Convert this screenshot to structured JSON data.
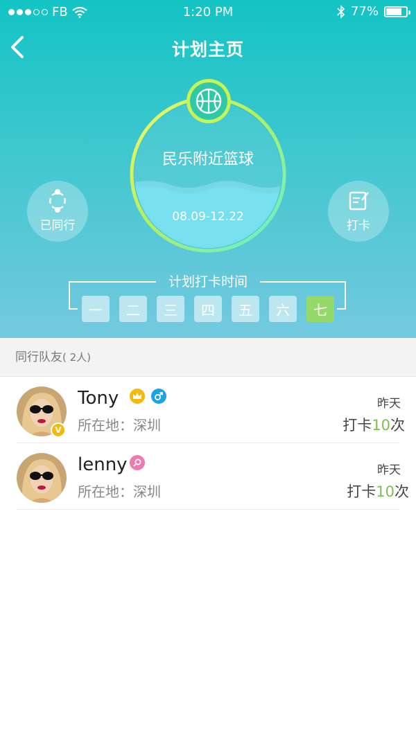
{
  "status_bar": {
    "carrier": "FB",
    "time": "1:20 PM",
    "battery": "77%",
    "battery_level": 0.77
  },
  "nav": {
    "title": "计划主页"
  },
  "plan": {
    "name": "民乐附近篮球",
    "dates": "08.09-12.22",
    "joined_label": "已同行",
    "checkin_label": "打卡"
  },
  "schedule": {
    "title": "计划打卡时间",
    "days": [
      "一",
      "二",
      "三",
      "四",
      "五",
      "六",
      "七"
    ],
    "active_day": "七"
  },
  "teammates": {
    "header_label": "同行队友",
    "header_count": "( 2人)",
    "members": [
      {
        "name": "Tony",
        "location": "所在地：深圳",
        "time": "昨天",
        "count_prefix": "打卡",
        "count": "10",
        "count_suffix": "次",
        "icons": [
          "crown-icon",
          "male-icon"
        ],
        "verified_badge": "V"
      },
      {
        "name": "lenny",
        "location": "所在地：深圳",
        "time": "昨天",
        "count_prefix": "打卡",
        "count": "10",
        "count_suffix": "次",
        "icons": [
          "female-icon"
        ]
      }
    ]
  },
  "colors": {
    "header_teal": "#13c4c4",
    "accent_green": "#7cc04e",
    "crown_yellow": "#f5b90c",
    "male_blue": "#1aa3e8",
    "female_pink": "#f07ab0",
    "active_day_green": "#95d96a"
  }
}
